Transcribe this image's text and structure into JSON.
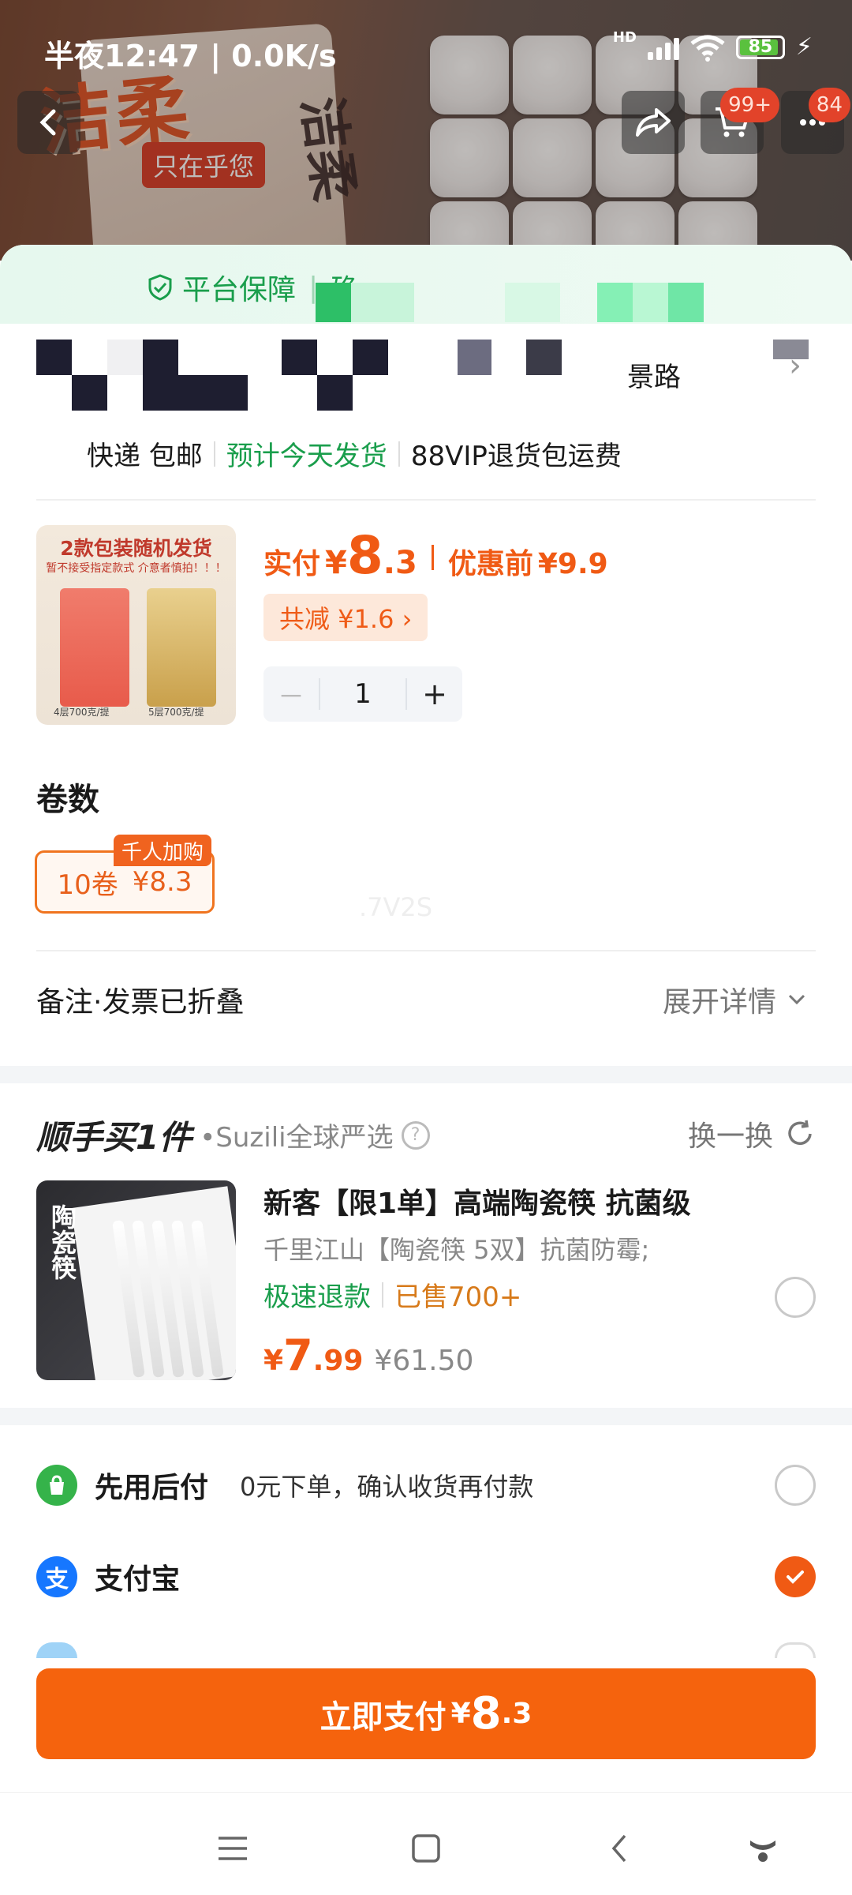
{
  "status_bar": {
    "time_speed": "半夜12:47 | 0.0K/s",
    "battery": "85",
    "hd": "HD"
  },
  "banner": {
    "brand_logo": "洁柔",
    "slogan": "只在乎您",
    "brand_logo_side": "洁柔",
    "cart_badge": "99+",
    "message_badge": "84"
  },
  "guarantee": {
    "label": "平台保障",
    "sep": "|",
    "more": "确..."
  },
  "address": {
    "tail": "景路"
  },
  "delivery": {
    "express": "快递 包邮",
    "ship": "预计今天发货",
    "vip": "88VIP退货包运费"
  },
  "product": {
    "img_headline": "2款包装随机发货",
    "img_sub": "暂不接受指定款式 介意者慎拍！！！",
    "img_label_left": "4层700克/提",
    "img_label_right": "5层700克/提",
    "price_label": "实付",
    "price_yen": "¥",
    "price_int": "8",
    "price_dec": ".3",
    "before_label": "优惠前",
    "before_price": "¥9.9",
    "discount": "共减 ¥1.6 ›",
    "qty": "1",
    "minus": "－",
    "plus": "+"
  },
  "spec": {
    "title": "卷数",
    "option_name": "10卷",
    "option_price": "¥8.3",
    "badge": "千人加购",
    "watermark": ".7V2S"
  },
  "remark": {
    "label": "备注·发票已折叠",
    "expand": "展开详情"
  },
  "recommend": {
    "brand": "顺手买1件",
    "shop": "•Suzili全球严选",
    "help": "?",
    "swap": "换一换",
    "img_tag": "陶瓷筷",
    "name": "新客【限1单】高端陶瓷筷 抗菌级",
    "desc": "千里江山【陶瓷筷 5双】抗菌防霉;",
    "tag_refund": "极速退款",
    "tag_sold": "已售700+",
    "price_yen": "¥",
    "price_int": "7",
    "price_dec": ".99",
    "orig_price": "¥61.50"
  },
  "payment": {
    "option1_name": "先用后付",
    "option1_note": "0元下单，确认收货再付款",
    "option2_name": "支付宝",
    "option2_icon": "支"
  },
  "pay_button": {
    "label": "立即支付",
    "yen": "¥",
    "int": "8",
    "dec": ".3"
  },
  "colors": {
    "accent": "#f5630d",
    "green": "#1a9e4c",
    "alipay": "#1677ff"
  }
}
